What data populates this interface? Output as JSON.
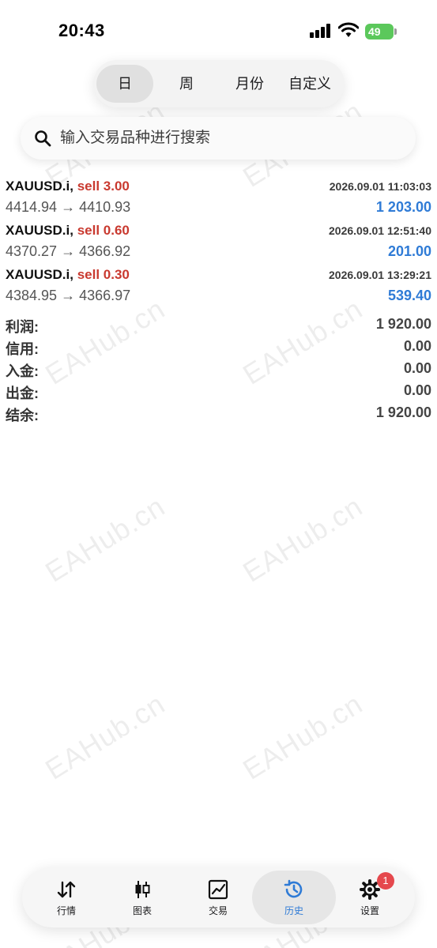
{
  "status_bar": {
    "time": "20:43",
    "battery": "49"
  },
  "period_tabs": [
    {
      "label": "日",
      "active": true
    },
    {
      "label": "周",
      "active": false
    },
    {
      "label": "月份",
      "active": false
    },
    {
      "label": "自定义",
      "active": false
    }
  ],
  "search": {
    "placeholder": "输入交易品种进行搜索",
    "value": ""
  },
  "deals": [
    {
      "symbol": "XAUUSD.i,",
      "side": "sell 3.00",
      "time": "2026.09.01 11:03:03",
      "prices": "4414.94 → 4410.93",
      "profit": "1 203.00"
    },
    {
      "symbol": "XAUUSD.i,",
      "side": "sell 0.60",
      "time": "2026.09.01 12:51:40",
      "prices": "4370.27 → 4366.92",
      "profit": "201.00"
    },
    {
      "symbol": "XAUUSD.i,",
      "side": "sell 0.30",
      "time": "2026.09.01 13:29:21",
      "prices": "4384.95 → 4366.97",
      "profit": "539.40"
    }
  ],
  "summary": [
    {
      "label": "利润:",
      "value": "1 920.00"
    },
    {
      "label": "信用:",
      "value": "0.00"
    },
    {
      "label": "入金:",
      "value": "0.00"
    },
    {
      "label": "出金:",
      "value": "0.00"
    },
    {
      "label": "结余:",
      "value": "1 920.00"
    }
  ],
  "watermark": "EAHub.cn",
  "bottom_nav": [
    {
      "label": "行情",
      "icon": "sort-arrows-icon",
      "active": false
    },
    {
      "label": "图表",
      "icon": "candlestick-icon",
      "active": false
    },
    {
      "label": "交易",
      "icon": "trade-chart-icon",
      "active": false
    },
    {
      "label": "历史",
      "icon": "history-clock-icon",
      "active": true
    },
    {
      "label": "设置",
      "icon": "gear-icon",
      "active": false,
      "badge": "1"
    }
  ],
  "colors": {
    "sell": "#c9392f",
    "profit": "#2f7bd6",
    "active_nav": "#2f7bd6",
    "badge": "#e5484d",
    "battery": "#5bc85b"
  }
}
